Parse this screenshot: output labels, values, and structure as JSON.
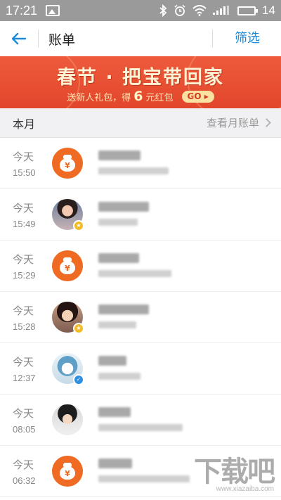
{
  "status_bar": {
    "time": "17:21",
    "battery": "14"
  },
  "nav": {
    "title": "账单",
    "filter": "筛选"
  },
  "banner": {
    "title": "春节 · 把宝带回家",
    "sub_prefix": "送新人礼包，得",
    "sub_number": "6",
    "sub_suffix": "元红包",
    "go": "GO ▸"
  },
  "section": {
    "title": "本月",
    "link": "查看月账单"
  },
  "transactions": [
    {
      "day": "今天",
      "time": "15:50",
      "avatar": "money-bag-icon"
    },
    {
      "day": "今天",
      "time": "15:49",
      "avatar": "user-photo"
    },
    {
      "day": "今天",
      "time": "15:29",
      "avatar": "money-bag-icon"
    },
    {
      "day": "今天",
      "time": "15:28",
      "avatar": "user-photo"
    },
    {
      "day": "今天",
      "time": "12:37",
      "avatar": "user-photo"
    },
    {
      "day": "今天",
      "time": "08:05",
      "avatar": "user-photo"
    },
    {
      "day": "今天",
      "time": "06:32",
      "avatar": "money-bag-icon"
    }
  ],
  "moneybag_symbol": "¥",
  "watermark": {
    "title": "下载吧",
    "url": "www.xiazaiba.com"
  },
  "colors": {
    "accent": "#1a8bdc",
    "banner": "#e84e31",
    "money_icon": "#ef6a22"
  }
}
